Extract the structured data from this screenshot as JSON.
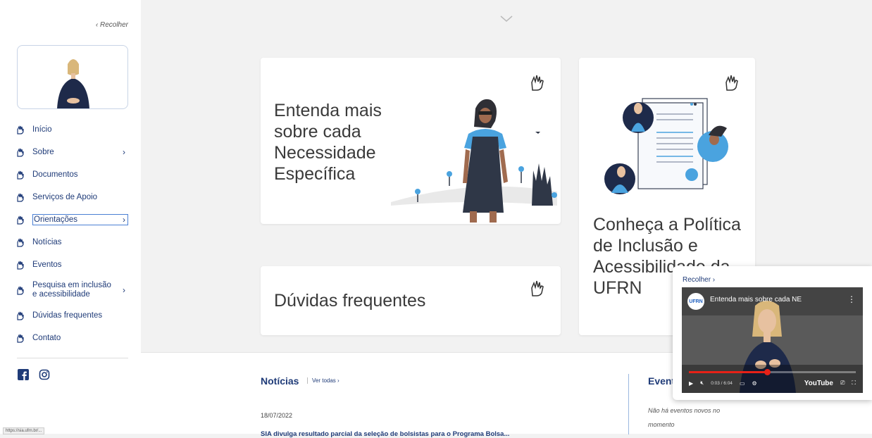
{
  "sidebar": {
    "collapse_label": "‹ Recolher",
    "items": [
      {
        "label": "Início",
        "has_submenu": false
      },
      {
        "label": "Sobre",
        "has_submenu": true
      },
      {
        "label": "Documentos",
        "has_submenu": false
      },
      {
        "label": "Serviços de Apoio",
        "has_submenu": false
      },
      {
        "label": "Orientações",
        "has_submenu": true
      },
      {
        "label": "Notícias",
        "has_submenu": false
      },
      {
        "label": "Eventos",
        "has_submenu": false
      },
      {
        "label": "Pesquisa em inclusão e acessibilidade",
        "has_submenu": true
      },
      {
        "label": "Dúvidas frequentes",
        "has_submenu": false
      },
      {
        "label": "Contato",
        "has_submenu": false
      }
    ],
    "chevron": "›",
    "social": [
      "facebook-icon",
      "instagram-icon"
    ],
    "status_url": "https://sia.ufrn.br/..."
  },
  "cards": {
    "necessidades": {
      "title": "Entenda mais sobre cada Necessidade Específica"
    },
    "politica": {
      "title": "Conheça a Política de Inclusão e Acessibilidade da UFRN"
    },
    "duvidas": {
      "title": "Dúvidas frequentes"
    }
  },
  "news": {
    "title": "Notícias",
    "see_all": "Ver todas ›",
    "date": "18/07/2022",
    "headline": "SIA divulga resultado parcial da seleção de bolsistas para o Programa Bolsa..."
  },
  "events": {
    "title": "Eventos",
    "empty": "Não há eventos novos no momento"
  },
  "video": {
    "collapse_label": "Recolher ›",
    "channel_logo": "UFRN",
    "title": "Entenda mais sobre cada NE",
    "time": "0:03 / 6:04",
    "brand": "YouTube",
    "progress": 0.47,
    "menu": "⋮"
  },
  "colors": {
    "accent": "#1f3b78",
    "progress": "#e62117",
    "figure_blue": "#4aa3df"
  }
}
